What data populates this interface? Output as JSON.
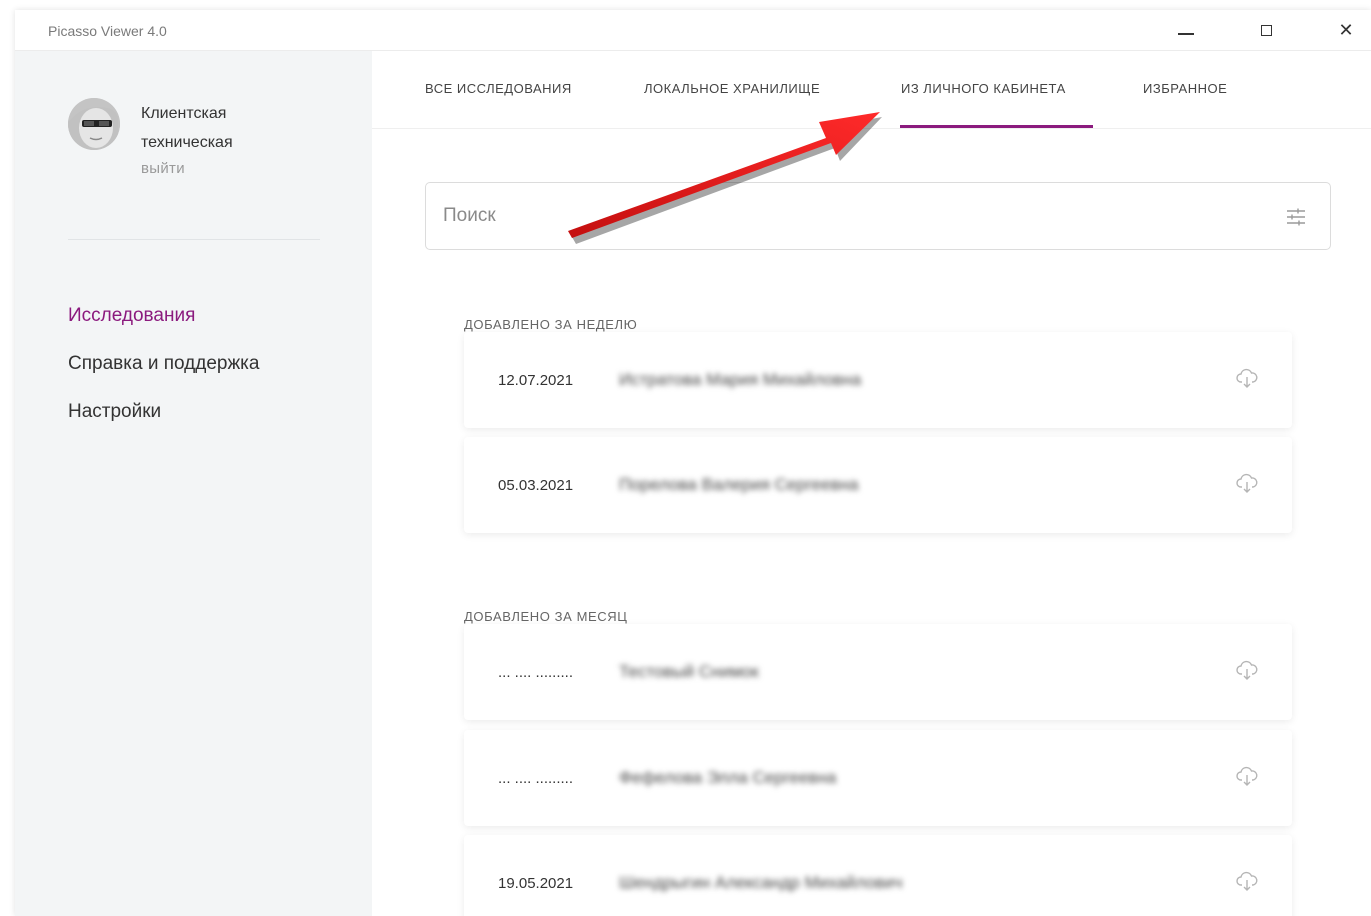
{
  "window": {
    "title": "Picasso Viewer 4.0"
  },
  "user": {
    "name_line1": "Клиентская",
    "name_line2": "техническая",
    "logout_label": "выйти"
  },
  "nav": {
    "items": [
      {
        "label": "Исследования",
        "active": true
      },
      {
        "label": "Справка и поддержка",
        "active": false
      },
      {
        "label": "Настройки",
        "active": false
      }
    ]
  },
  "tabs": [
    {
      "label": "ВСЕ ИССЛЕДОВАНИЯ",
      "active": false
    },
    {
      "label": "ЛОКАЛЬНОЕ ХРАНИЛИЩЕ",
      "active": false
    },
    {
      "label": "ИЗ ЛИЧНОГО КАБИНЕТА",
      "active": true
    },
    {
      "label": "ИЗБРАННОЕ",
      "active": false
    }
  ],
  "search": {
    "placeholder": "Поиск",
    "value": "",
    "filter_icon": "filter-sliders-icon"
  },
  "sections": [
    {
      "title": "ДОБАВЛЕНО ЗА НЕДЕЛЮ",
      "items": [
        {
          "date": "12.07.2021",
          "name": "Истратова Мария Михайловна",
          "icon": "cloud-download-icon"
        },
        {
          "date": "05.03.2021",
          "name": "Порелова Валерия Сергеевна",
          "icon": "cloud-download-icon"
        }
      ]
    },
    {
      "title": "ДОБАВЛЕНО ЗА МЕСЯЦ",
      "items": [
        {
          "date": "... .... .........",
          "name": "Тестовый Снимок",
          "icon": "cloud-download-icon"
        },
        {
          "date": "... .... .........",
          "name": "Фефелова Элла Сергеевна",
          "icon": "cloud-download-icon"
        },
        {
          "date": "19.05.2021",
          "name": "Шендрыгин Александр Михайлович",
          "icon": "cloud-download-icon"
        }
      ]
    }
  ],
  "colors": {
    "accent": "#8b1a7e",
    "annotation_arrow": "#e31a1a",
    "sidebar_bg": "#f3f5f6"
  }
}
